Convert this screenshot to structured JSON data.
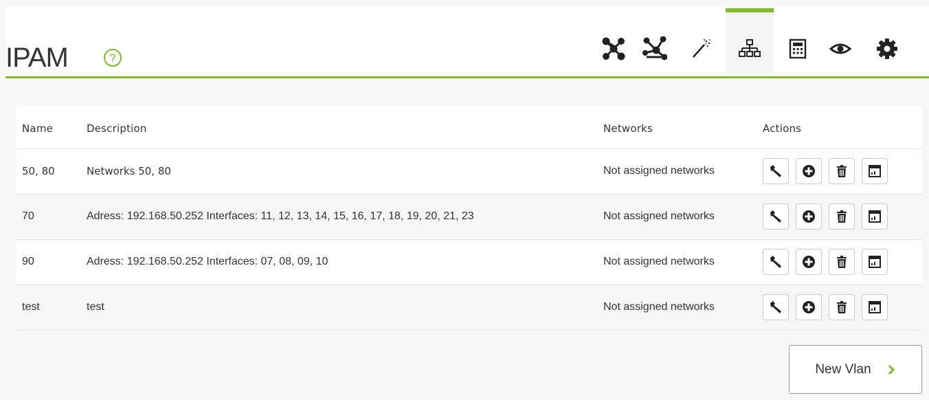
{
  "header": {
    "title": "IPAM",
    "accent_color": "#82b92e",
    "tabs": [
      {
        "icon": "network-graph-icon",
        "active": false
      },
      {
        "icon": "network-nodes-icon",
        "active": false
      },
      {
        "icon": "magic-wand-icon",
        "active": false
      },
      {
        "icon": "sitemap-icon",
        "active": true
      },
      {
        "icon": "calculator-icon",
        "active": false
      },
      {
        "icon": "eye-icon",
        "active": false
      },
      {
        "icon": "gear-icon",
        "active": false
      }
    ]
  },
  "table": {
    "columns": {
      "name": "Name",
      "description": "Description",
      "networks": "Networks",
      "actions": "Actions"
    },
    "rows": [
      {
        "name": "50, 80",
        "description": "Networks 50, 80",
        "networks": "Not assigned networks"
      },
      {
        "name": "70",
        "description": "Adress: 192.168.50.252 Interfaces: 11, 12, 13, 14, 15, 16, 17, 18, 19, 20, 21, 23",
        "networks": "Not assigned networks"
      },
      {
        "name": "90",
        "description": "Adress: 192.168.50.252 Interfaces: 07, 08, 09, 10",
        "networks": "Not assigned networks"
      },
      {
        "name": "test",
        "description": "test",
        "networks": "Not assigned networks"
      }
    ],
    "action_icons": [
      "wrench-icon",
      "add-circle-icon",
      "trash-icon",
      "report-icon"
    ]
  },
  "new_vlan_button": {
    "label": "New Vlan"
  }
}
